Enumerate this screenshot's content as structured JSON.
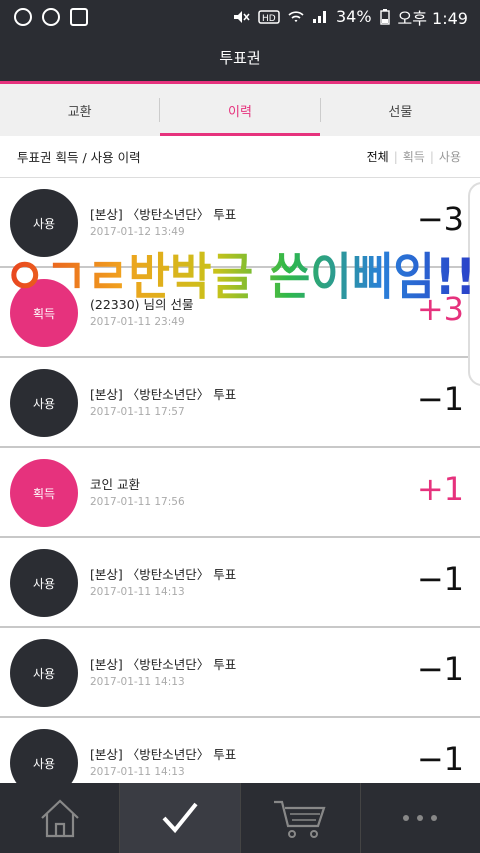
{
  "status": {
    "battery": "34%",
    "time": "오후 1:49"
  },
  "app": {
    "title": "투표권"
  },
  "tabs": [
    {
      "label": "교환"
    },
    {
      "label": "이력"
    },
    {
      "label": "선물"
    }
  ],
  "section": {
    "title": "투표권 획득 / 사용 이력",
    "filters": [
      "전체",
      "획득",
      "사용"
    ]
  },
  "rows": [
    {
      "badge": "사용",
      "title": "[본상] 〈방탄소년단〉 투표",
      "date": "2017-01-12 13:49",
      "amount": "−3"
    },
    {
      "badge": "획득",
      "title": "(22330) 님의 선물",
      "date": "2017-01-11 23:49",
      "amount": "+3"
    },
    {
      "badge": "사용",
      "title": "[본상] 〈방탄소년단〉 투표",
      "date": "2017-01-11 17:57",
      "amount": "−1"
    },
    {
      "badge": "획득",
      "title": "코인 교환",
      "date": "2017-01-11 17:56",
      "amount": "+1"
    },
    {
      "badge": "사용",
      "title": "[본상] 〈방탄소년단〉 투표",
      "date": "2017-01-11 14:13",
      "amount": "−1"
    },
    {
      "badge": "사용",
      "title": "[본상] 〈방탄소년단〉 투표",
      "date": "2017-01-11 14:13",
      "amount": "−1"
    },
    {
      "badge": "사용",
      "title": "[본상] 〈방탄소년단〉 투표",
      "date": "2017-01-11 14:13",
      "amount": "−1"
    }
  ],
  "overlay_text": "ㅇㄱㄹ반박글 쓴이삐임!!",
  "nav": [
    "home-icon",
    "check-icon",
    "cart-icon",
    "more-icon"
  ],
  "colors": {
    "accent": "#e6327d",
    "dark": "#2b2d33"
  }
}
